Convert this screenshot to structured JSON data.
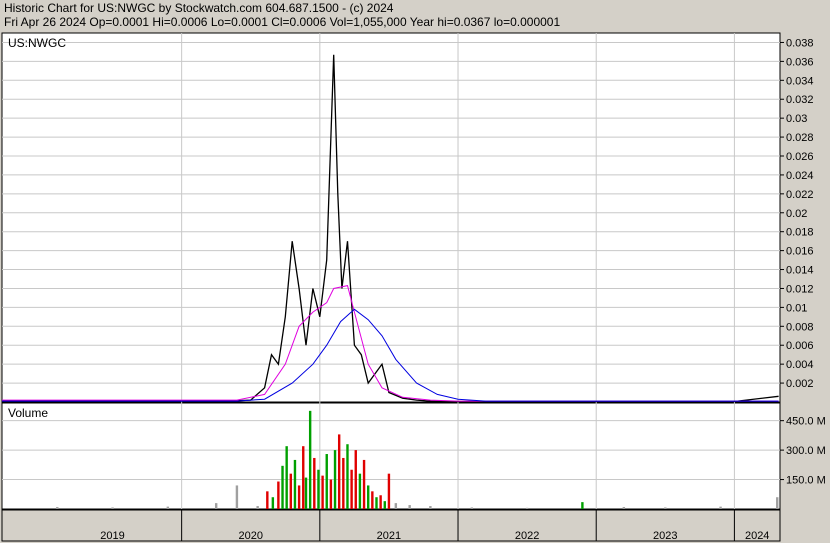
{
  "header": {
    "line1": "Historic Chart for US:NWGC by Stockwatch.com 604.687.1500 - (c) 2024",
    "line2": "Fri Apr 26 2024   Op=0.0001   Hi=0.0006   Lo=0.0001   Cl=0.0006   Vol=1,055,000   Year hi=0.0367   lo=0.000001"
  },
  "colors": {
    "price": "#000000",
    "ma_short": "#e000e0",
    "ma_long": "#0000e0",
    "volume_up": "#00a000",
    "volume_down": "#e00000",
    "volume_neutral": "#a0a0a0",
    "grid": "#c8c8c8",
    "panel_bg": "#ffffff",
    "frame_bg": "#d4d0c8"
  },
  "chart_data": [
    {
      "type": "line",
      "panel_label": "US:NWGC",
      "y_ticks": [
        "0.002",
        "0.004",
        "0.006",
        "0.008",
        "0.01",
        "0.012",
        "0.014",
        "0.016",
        "0.018",
        "0.02",
        "0.022",
        "0.024",
        "0.026",
        "0.028",
        "0.03",
        "0.032",
        "0.034",
        "0.036",
        "0.038"
      ],
      "ylim": [
        0,
        0.039
      ],
      "xlim": [
        2018.7,
        2024.33
      ],
      "x_labels": [
        "2019",
        "2020",
        "2021",
        "2022",
        "2023",
        "2024"
      ],
      "grid": true,
      "series": [
        {
          "role": "price",
          "x": [
            2018.7,
            2019.0,
            2019.5,
            2020.0,
            2020.3,
            2020.5,
            2020.6,
            2020.65,
            2020.7,
            2020.75,
            2020.8,
            2020.85,
            2020.9,
            2020.95,
            2021.0,
            2021.05,
            2021.1,
            2021.13,
            2021.16,
            2021.2,
            2021.25,
            2021.3,
            2021.35,
            2021.4,
            2021.45,
            2021.5,
            2021.6,
            2021.7,
            2021.8,
            2022.0,
            2022.5,
            2023.0,
            2023.5,
            2024.0,
            2024.32
          ],
          "y": [
            0.0001,
            0.0001,
            0.0001,
            0.0001,
            0.0001,
            0.0002,
            0.0015,
            0.005,
            0.004,
            0.009,
            0.017,
            0.012,
            0.006,
            0.012,
            0.009,
            0.015,
            0.0367,
            0.022,
            0.012,
            0.017,
            0.006,
            0.005,
            0.002,
            0.003,
            0.004,
            0.001,
            0.0004,
            0.0002,
            0.0001,
            5e-05,
            5e-05,
            5e-05,
            5e-05,
            5e-05,
            0.0006
          ]
        },
        {
          "role": "ma_short",
          "x": [
            2018.7,
            2020.4,
            2020.6,
            2020.75,
            2020.85,
            2020.95,
            2021.05,
            2021.1,
            2021.2,
            2021.25,
            2021.35,
            2021.45,
            2021.6,
            2021.8,
            2022.0,
            2024.32
          ],
          "y": [
            0.0002,
            0.0002,
            0.0008,
            0.004,
            0.008,
            0.0095,
            0.0105,
            0.012,
            0.0123,
            0.0095,
            0.004,
            0.0015,
            0.0005,
            0.0002,
            0.0001,
            0.0001
          ]
        },
        {
          "role": "ma_long",
          "x": [
            2018.7,
            2020.4,
            2020.6,
            2020.8,
            2020.95,
            2021.05,
            2021.15,
            2021.25,
            2021.35,
            2021.45,
            2021.55,
            2021.7,
            2021.85,
            2022.0,
            2022.2,
            2024.32
          ],
          "y": [
            0.0001,
            0.0001,
            0.0003,
            0.002,
            0.004,
            0.006,
            0.0085,
            0.0098,
            0.0087,
            0.007,
            0.0045,
            0.002,
            0.0008,
            0.0003,
            0.0001,
            0.0001
          ]
        }
      ]
    },
    {
      "type": "bar",
      "panel_label": "Volume",
      "y_ticks": [
        "150.0 M",
        "300.0 M",
        "450.0 M"
      ],
      "ylim": [
        0,
        540
      ],
      "bars": [
        {
          "x": 2019.1,
          "v": 10,
          "c": "volume_neutral"
        },
        {
          "x": 2019.5,
          "v": 8,
          "c": "volume_neutral"
        },
        {
          "x": 2019.9,
          "v": 12,
          "c": "volume_neutral"
        },
        {
          "x": 2020.25,
          "v": 30,
          "c": "volume_neutral"
        },
        {
          "x": 2020.4,
          "v": 120,
          "c": "volume_neutral"
        },
        {
          "x": 2020.55,
          "v": 15,
          "c": "volume_neutral"
        },
        {
          "x": 2020.62,
          "v": 90,
          "c": "volume_down"
        },
        {
          "x": 2020.66,
          "v": 60,
          "c": "volume_up"
        },
        {
          "x": 2020.7,
          "v": 140,
          "c": "volume_down"
        },
        {
          "x": 2020.73,
          "v": 220,
          "c": "volume_up"
        },
        {
          "x": 2020.76,
          "v": 320,
          "c": "volume_up"
        },
        {
          "x": 2020.79,
          "v": 180,
          "c": "volume_down"
        },
        {
          "x": 2020.82,
          "v": 250,
          "c": "volume_up"
        },
        {
          "x": 2020.85,
          "v": 120,
          "c": "volume_down"
        },
        {
          "x": 2020.88,
          "v": 320,
          "c": "volume_down"
        },
        {
          "x": 2020.9,
          "v": 160,
          "c": "volume_up"
        },
        {
          "x": 2020.93,
          "v": 500,
          "c": "volume_up"
        },
        {
          "x": 2020.96,
          "v": 260,
          "c": "volume_down"
        },
        {
          "x": 2020.99,
          "v": 200,
          "c": "volume_up"
        },
        {
          "x": 2021.02,
          "v": 170,
          "c": "volume_down"
        },
        {
          "x": 2021.05,
          "v": 280,
          "c": "volume_up"
        },
        {
          "x": 2021.08,
          "v": 150,
          "c": "volume_down"
        },
        {
          "x": 2021.11,
          "v": 300,
          "c": "volume_up"
        },
        {
          "x": 2021.14,
          "v": 380,
          "c": "volume_down"
        },
        {
          "x": 2021.17,
          "v": 260,
          "c": "volume_down"
        },
        {
          "x": 2021.2,
          "v": 330,
          "c": "volume_up"
        },
        {
          "x": 2021.23,
          "v": 200,
          "c": "volume_down"
        },
        {
          "x": 2021.26,
          "v": 300,
          "c": "volume_down"
        },
        {
          "x": 2021.29,
          "v": 180,
          "c": "volume_up"
        },
        {
          "x": 2021.32,
          "v": 250,
          "c": "volume_down"
        },
        {
          "x": 2021.35,
          "v": 120,
          "c": "volume_up"
        },
        {
          "x": 2021.38,
          "v": 90,
          "c": "volume_down"
        },
        {
          "x": 2021.41,
          "v": 60,
          "c": "volume_up"
        },
        {
          "x": 2021.44,
          "v": 70,
          "c": "volume_down"
        },
        {
          "x": 2021.47,
          "v": 40,
          "c": "volume_up"
        },
        {
          "x": 2021.5,
          "v": 180,
          "c": "volume_down"
        },
        {
          "x": 2021.55,
          "v": 30,
          "c": "volume_neutral"
        },
        {
          "x": 2021.65,
          "v": 20,
          "c": "volume_neutral"
        },
        {
          "x": 2021.8,
          "v": 15,
          "c": "volume_neutral"
        },
        {
          "x": 2022.1,
          "v": 8,
          "c": "volume_neutral"
        },
        {
          "x": 2022.5,
          "v": 6,
          "c": "volume_neutral"
        },
        {
          "x": 2022.9,
          "v": 35,
          "c": "volume_up"
        },
        {
          "x": 2023.2,
          "v": 10,
          "c": "volume_neutral"
        },
        {
          "x": 2023.5,
          "v": 8,
          "c": "volume_neutral"
        },
        {
          "x": 2023.9,
          "v": 12,
          "c": "volume_neutral"
        },
        {
          "x": 2024.31,
          "v": 60,
          "c": "volume_neutral"
        }
      ]
    }
  ]
}
